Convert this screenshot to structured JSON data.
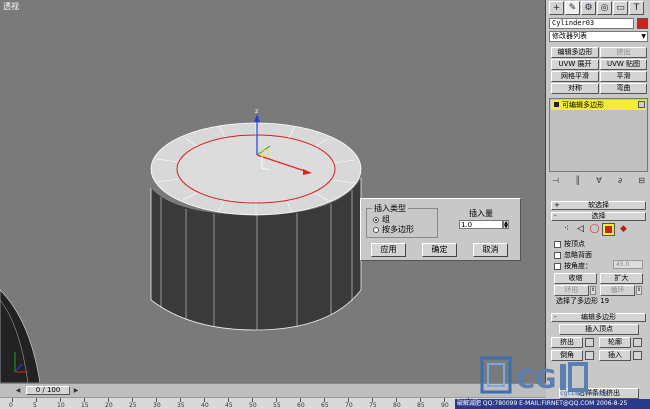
{
  "viewport": {
    "label": "透视",
    "axis_label": "z"
  },
  "dialog": {
    "group_title": "插入类型",
    "option_group": "组",
    "option_polygon": "按多边形",
    "amount_label": "插入量",
    "amount_value": "1.0",
    "apply": "应用",
    "ok": "确定",
    "cancel": "取消"
  },
  "timeline": {
    "slider_text": "0 / 100",
    "ticks": [
      "0",
      "5",
      "10",
      "15",
      "20",
      "25",
      "30",
      "35",
      "40",
      "45",
      "50",
      "55",
      "60",
      "65",
      "70",
      "75",
      "80",
      "85",
      "90",
      "95"
    ]
  },
  "panel": {
    "tabs": [
      "+",
      "✎",
      "⚙",
      "◎",
      "▭",
      "T"
    ],
    "object_name": "Cylinder03",
    "modifier_list": "修改器列表",
    "buttons": {
      "edit_poly": "编辑多边形",
      "extrude": "挤出",
      "uvw_unwrap": "UVW 展开",
      "uvw_map": "UVW 贴图",
      "meshsmooth": "网格平滑",
      "smooth": "平滑",
      "symmetry": "对称",
      "bend": "弯曲"
    },
    "stack_item": "可编辑多边形",
    "soft_select": "软选择",
    "selection": "选择",
    "by_vertex": "按顶点",
    "ignore_backfacing": "忽略背面",
    "by_angle": "按角度：",
    "angle_value": "45.0",
    "shrink": "收缩",
    "grow": "扩大",
    "ring": "环形",
    "loop": "循环",
    "selection_status": "选择了多边形 19",
    "edit_polygons": "编辑多边形",
    "insert_vertex": "插入顶点",
    "extrude2": "挤出",
    "outline": "轮廓",
    "bevel": "倒角",
    "inset": "插入",
    "bottom_partial": "沿样条线挤出"
  },
  "status": {
    "text": "破解减肥  QQ:780099  E-MAIL:FIRNET@QQ.COM  2006-8-25",
    "site": "cgtime.com.cn",
    "logo": "CG"
  }
}
